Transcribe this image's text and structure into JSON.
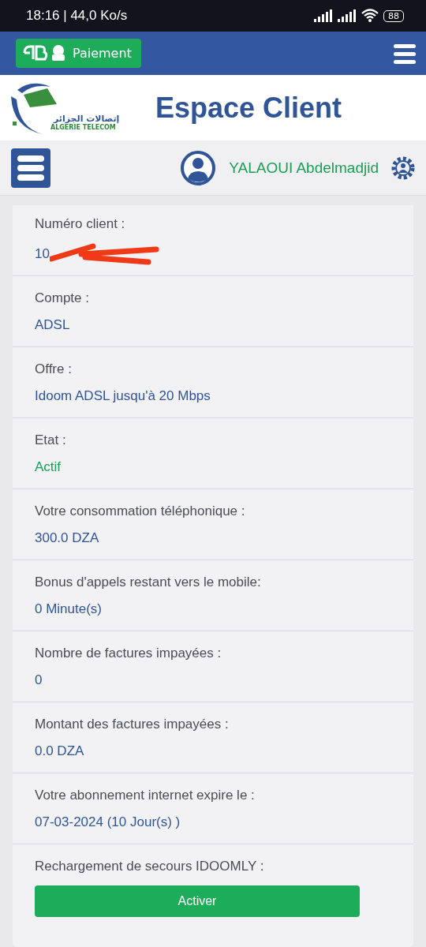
{
  "status_bar": {
    "time_speed": "18:16 | 44,0 Ko/s",
    "battery": "88"
  },
  "nav": {
    "payment_button": "Paiement"
  },
  "header": {
    "logo_arabic": "إتصالات الجزائر",
    "logo_latin": "ALGERIE TELECOM",
    "title": "Espace Client"
  },
  "user_bar": {
    "name": "YALAOUI Abdelmadjid"
  },
  "details": [
    {
      "kind": "redacted",
      "label": "Numéro client :",
      "value": "10"
    },
    {
      "kind": "value",
      "label": "Compte :",
      "value": "ADSL"
    },
    {
      "kind": "value",
      "label": "Offre :",
      "value": "Idoom ADSL jusqu'à 20 Mbps"
    },
    {
      "kind": "status",
      "label": "Etat :",
      "value": "Actif"
    },
    {
      "kind": "value",
      "label": "Votre consommation téléphonique :",
      "value": "300.0 DZA"
    },
    {
      "kind": "value",
      "label": "Bonus d'appels restant vers le mobile:",
      "value": "0 Minute(s)"
    },
    {
      "kind": "value",
      "label": "Nombre de factures impayées :",
      "value": "0"
    },
    {
      "kind": "value",
      "label": "Montant des factures impayées :",
      "value": "0.0 DZA"
    },
    {
      "kind": "value",
      "label": "Votre abonnement internet expire le :",
      "value": "07-03-2024 (10 Jour(s) )"
    },
    {
      "kind": "action",
      "label": "Rechargement de secours IDOOMLY :",
      "value": "Activer"
    }
  ]
}
